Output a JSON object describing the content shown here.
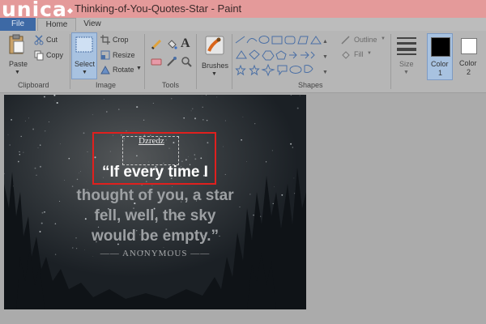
{
  "window": {
    "title": "Thinking-of-You-Quotes-Star - Paint"
  },
  "watermark": {
    "text": "unica"
  },
  "tabs": [
    {
      "label": "File"
    },
    {
      "label": "Home"
    },
    {
      "label": "View"
    }
  ],
  "ribbon": {
    "clipboard": {
      "group_label": "Clipboard",
      "paste": "Paste",
      "cut": "Cut",
      "copy": "Copy"
    },
    "image": {
      "group_label": "Image",
      "select": "Select",
      "crop": "Crop",
      "resize": "Resize",
      "rotate": "Rotate"
    },
    "tools": {
      "group_label": "Tools"
    },
    "brushes": {
      "label": "Brushes"
    },
    "shapes": {
      "group_label": "Shapes",
      "outline": "Outline",
      "fill": "Fill"
    },
    "size": {
      "label": "Size"
    },
    "color1": {
      "label": "Color",
      "number": "1",
      "value": "#000000"
    },
    "color2": {
      "label": "Color",
      "number": "2",
      "value": "#ffffff"
    }
  },
  "canvas": {
    "quote_lines": [
      "“If every time I",
      "thought of you, a star",
      "fell, well, the sky",
      "would be empty.”"
    ],
    "author": "—— ANONYMOUS ——",
    "textbox_text": "Dzredz"
  },
  "colors": {
    "titlebar": "#e49a9a",
    "file_tab": "#3d69a5",
    "selection": "#e0201e"
  }
}
